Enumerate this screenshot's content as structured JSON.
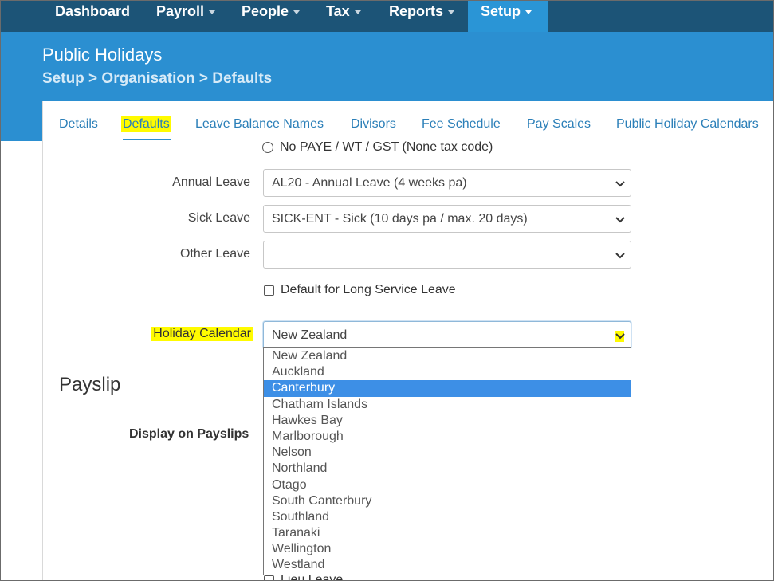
{
  "nav": {
    "items": [
      {
        "label": "Dashboard",
        "caret": false
      },
      {
        "label": "Payroll",
        "caret": true
      },
      {
        "label": "People",
        "caret": true
      },
      {
        "label": "Tax",
        "caret": true
      },
      {
        "label": "Reports",
        "caret": true
      },
      {
        "label": "Setup",
        "caret": true,
        "active": true
      }
    ]
  },
  "header": {
    "title": "Public Holidays",
    "breadcrumb": "Setup > Organisation > Defaults"
  },
  "tabs": [
    {
      "label": "Details"
    },
    {
      "label": "Defaults",
      "active": true
    },
    {
      "label": "Leave Balance Names"
    },
    {
      "label": "Divisors"
    },
    {
      "label": "Fee Schedule"
    },
    {
      "label": "Pay Scales"
    },
    {
      "label": "Public Holiday Calendars"
    }
  ],
  "form": {
    "tax_radio_label": "No PAYE / WT / GST (None tax code)",
    "annual_leave": {
      "label": "Annual Leave",
      "value": "AL20 - Annual Leave (4 weeks pa)"
    },
    "sick_leave": {
      "label": "Sick Leave",
      "value": "SICK-ENT - Sick (10 days pa / max. 20 days)"
    },
    "other_leave": {
      "label": "Other Leave",
      "value": ""
    },
    "long_service_checkbox": "Default for Long Service Leave",
    "holiday_calendar": {
      "label": "Holiday Calendar",
      "value": "New Zealand",
      "options": [
        "New Zealand",
        "Auckland",
        "Canterbury",
        "Chatham Islands",
        "Hawkes Bay",
        "Marlborough",
        "Nelson",
        "Northland",
        "Otago",
        "South Canterbury",
        "Southland",
        "Taranaki",
        "Wellington",
        "Westland"
      ],
      "highlighted_option": "Canterbury"
    }
  },
  "payslip": {
    "section_title": "Payslip",
    "display_label": "Display on Payslips",
    "partial_row_label": "Lieu Leave"
  },
  "colors": {
    "nav_bg": "#1c5477",
    "nav_active": "#2a95d6",
    "header_bg": "#2b8fd1",
    "link": "#2b7fb8",
    "highlight": "#fffb00",
    "selected_option": "#3d8fe6"
  }
}
